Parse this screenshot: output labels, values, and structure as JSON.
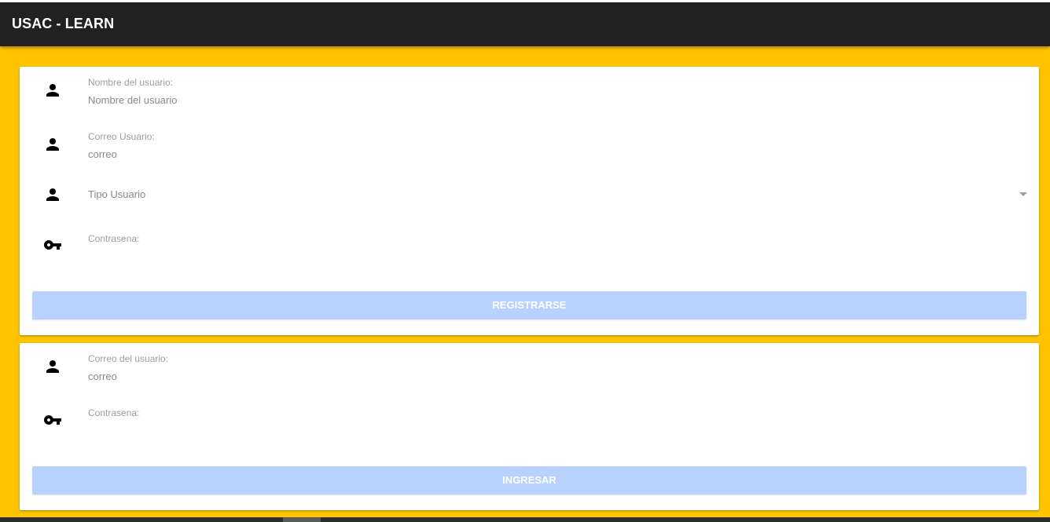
{
  "app": {
    "title": "USAC - LEARN"
  },
  "register": {
    "name_label": "Nombre del usuario:",
    "name_placeholder": "Nombre del usuario",
    "email_label": "Correo Usuario:",
    "email_placeholder": "correo",
    "type_placeholder": "Tipo Usuario",
    "password_label": "Contrasena:",
    "password_value": "",
    "submit_label": "REGISTRARSE"
  },
  "login": {
    "email_label": "Correo del usuario:",
    "email_placeholder": "correo",
    "password_label": "Contrasena:",
    "password_value": "",
    "submit_label": "INGRESAR"
  },
  "icons": {
    "person": "person-icon",
    "key": "key-icon",
    "dropdown": "arrow-drop-down-icon"
  },
  "colors": {
    "background": "#ffc400",
    "appbar": "#212121",
    "button": "#b8d2ff"
  }
}
